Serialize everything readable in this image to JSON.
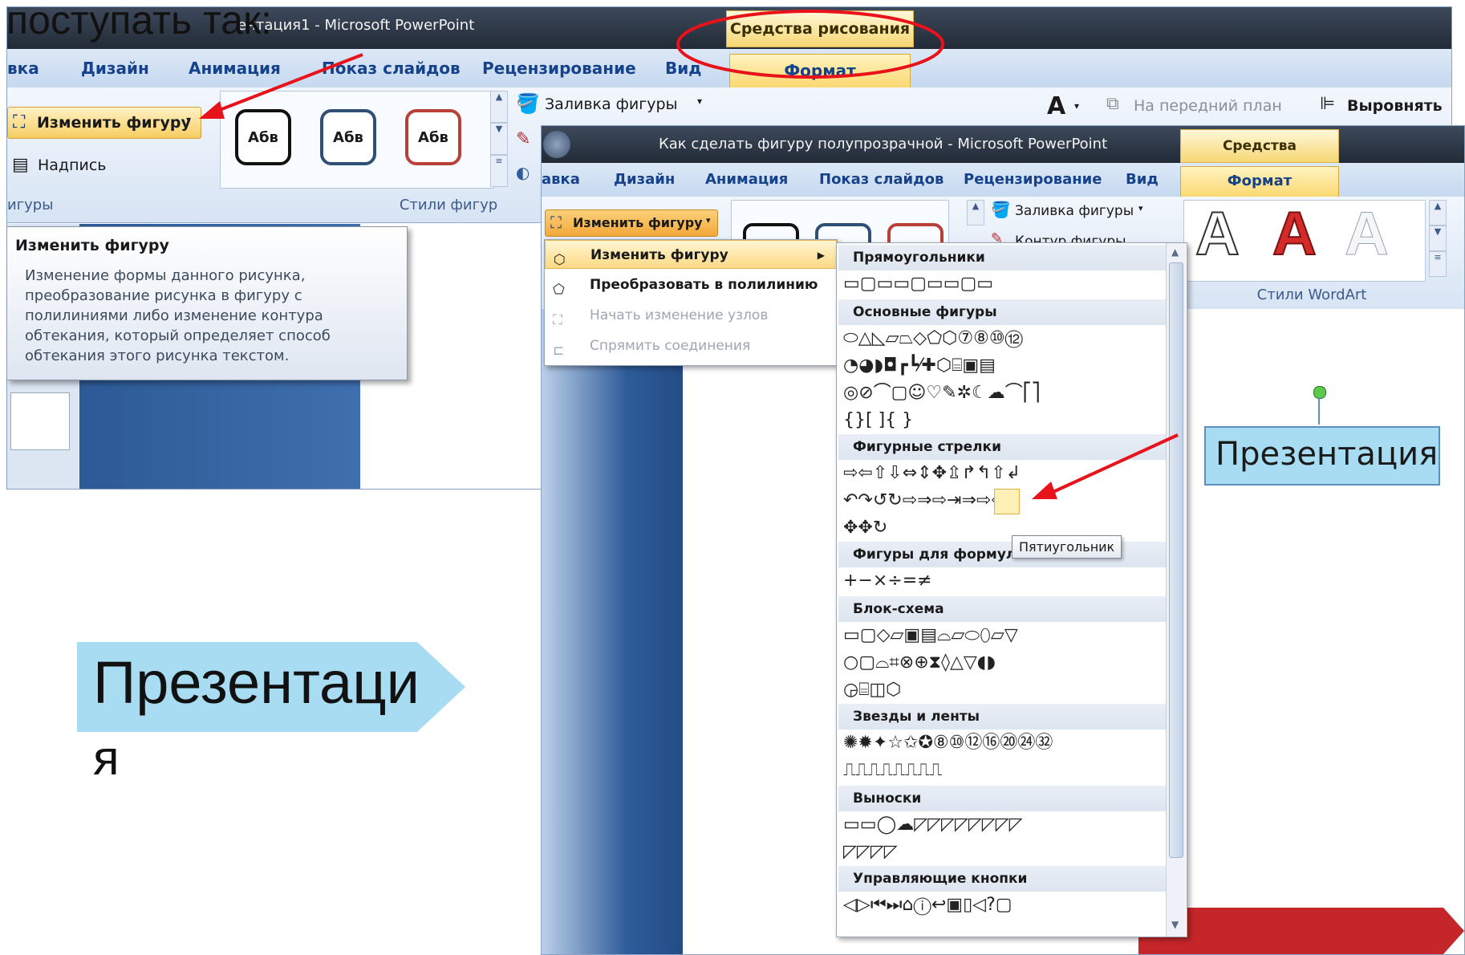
{
  "caption_top": "поступать так:",
  "slide_text_line1": "Презентаци",
  "slide_text_line2": "я",
  "back": {
    "title": "Презентация1 - Microsoft PowerPoint",
    "title_visible": "ентация1 - Microsoft PowerPoint",
    "contextual_header": "Средства рисования",
    "tabs": [
      "вка",
      "Дизайн",
      "Анимация",
      "Показ слайдов",
      "Рецензирование",
      "Вид",
      "Формат"
    ],
    "edit_shape_button": "Изменить фигуру",
    "textbox_button": "Надпись",
    "group_shapes_label": "игуры",
    "shape_style_thumb": "Абв",
    "group_styles_label": "Стили фигур",
    "fill_button": "Заливка фигуры",
    "bring_forward": "На передний план",
    "align": "Выровнять"
  },
  "tooltip": {
    "title": "Изменить фигуру",
    "lines": [
      "Изменение формы данного рисунка,",
      "преобразование рисунка в фигуру с",
      "полилиниями либо изменение контура",
      "обтекания, который определяет способ",
      "обтекания этого рисунка текстом."
    ]
  },
  "front": {
    "title": "Как сделать фигуру полупрозрачной - Microsoft PowerPoint",
    "contextual_header": "Средства рисования",
    "tabs": [
      "авка",
      "Дизайн",
      "Анимация",
      "Показ слайдов",
      "Рецензирование",
      "Вид",
      "Формат"
    ],
    "edit_shape_button": "Изменить фигуру",
    "fill_button": "Заливка фигуры",
    "outline_button": "Контур фигуры",
    "wordart_label": "Стили WordArt",
    "selected_shape_text": "Презентация"
  },
  "menu": {
    "items": [
      {
        "label": "Изменить фигуру",
        "state": "hover"
      },
      {
        "label": "Преобразовать в полилинию",
        "state": "normal"
      },
      {
        "label": "Начать изменение узлов",
        "state": "disabled"
      },
      {
        "label": "Спрямить соединения",
        "state": "disabled"
      }
    ]
  },
  "gallery": {
    "tooltip": "Пятиугольник",
    "sections": [
      {
        "title": "Прямоугольники",
        "rows": [
          "▭▢▭▭▢▭▭▢▭"
        ]
      },
      {
        "title": "Основные фигуры",
        "rows": [
          "⬭△◺▱⏢◇⬠⬡⑦⑧⑩⑫",
          "◔◕◗◘┏┗⁄✚⬡⌸▣▤",
          "◎⊘⌒▢☺♡✎✲☾☁⌒⎡⎤",
          "{}[ ]{ }"
        ]
      },
      {
        "title": "Фигурные стрелки",
        "rows": [
          "⇨⇦⇧⇩⇔⇕✥⇫↱↰⇧↲",
          "↶↷↺↻⇨⇒⇨⇥⇒⇨⇦⇧",
          "✥✥↻"
        ]
      },
      {
        "title": "Фигуры для формул",
        "rows": [
          "+−×÷=≠"
        ]
      },
      {
        "title": "Блок-схема",
        "rows": [
          "▭▢◇▱▣▤⌓▱⬭⬯▱▽",
          "○▢⌓⌗⊗⊕⧗◊△▽◖◗",
          "◶⌸◫⬡"
        ]
      },
      {
        "title": "Звезды и ленты",
        "rows": [
          "✺✹✦☆✩✪⑧⑩⑫⑯⑳㉔㉜",
          "⎍⎍⎍⎍⎍⎍⎍⎍"
        ]
      },
      {
        "title": "Выноски",
        "rows": [
          "▭▭◯☁◸◸◸◸◸◸◸◸",
          "◸◸◸◸"
        ]
      },
      {
        "title": "Управляющие кнопки",
        "rows": [
          "◁▷⏮⏭⌂ⓘ↩▣▯◁?▢"
        ]
      }
    ]
  },
  "colors": {
    "accent_red": "#e8121b",
    "slide_blue": "#2e5c9a",
    "arrow_shape": "#a8dcf2",
    "red_button": "#c4262a"
  }
}
